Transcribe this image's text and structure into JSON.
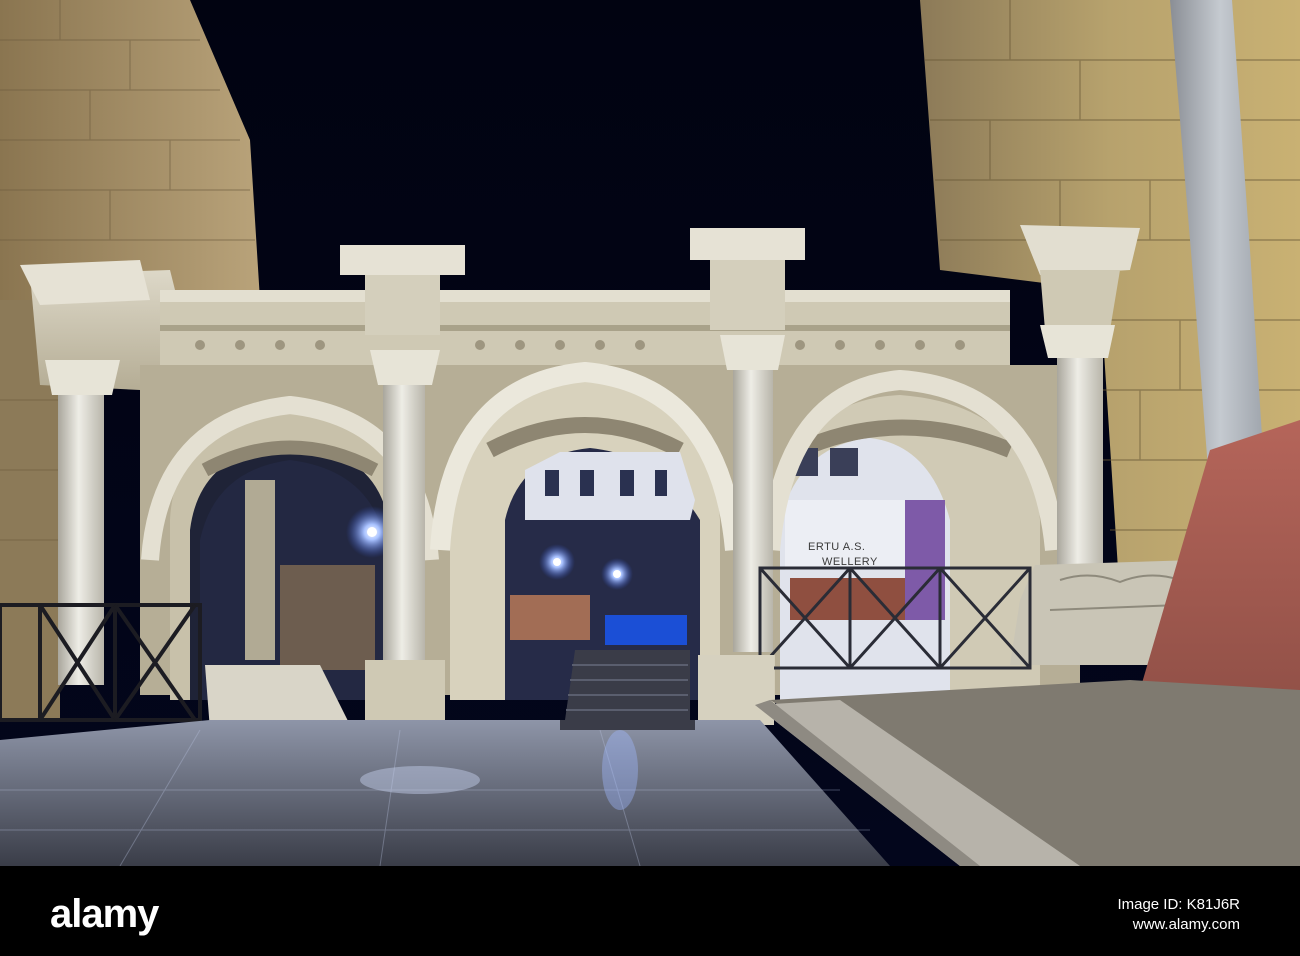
{
  "scene": {
    "description_colors": {
      "sky": "#020414",
      "stone": "#c9c1a6",
      "marble": "#e8e6dc",
      "wall": "#a08a60",
      "plaza": "#5c6172",
      "light": "#9fb8ff"
    },
    "shop_sign_line1": "ERTU A.S.",
    "shop_sign_line2": "WELLERY"
  },
  "footer": {
    "logo": "alamy",
    "image_id_label": "Image ID: K81J6R",
    "site": "www.alamy.com"
  }
}
